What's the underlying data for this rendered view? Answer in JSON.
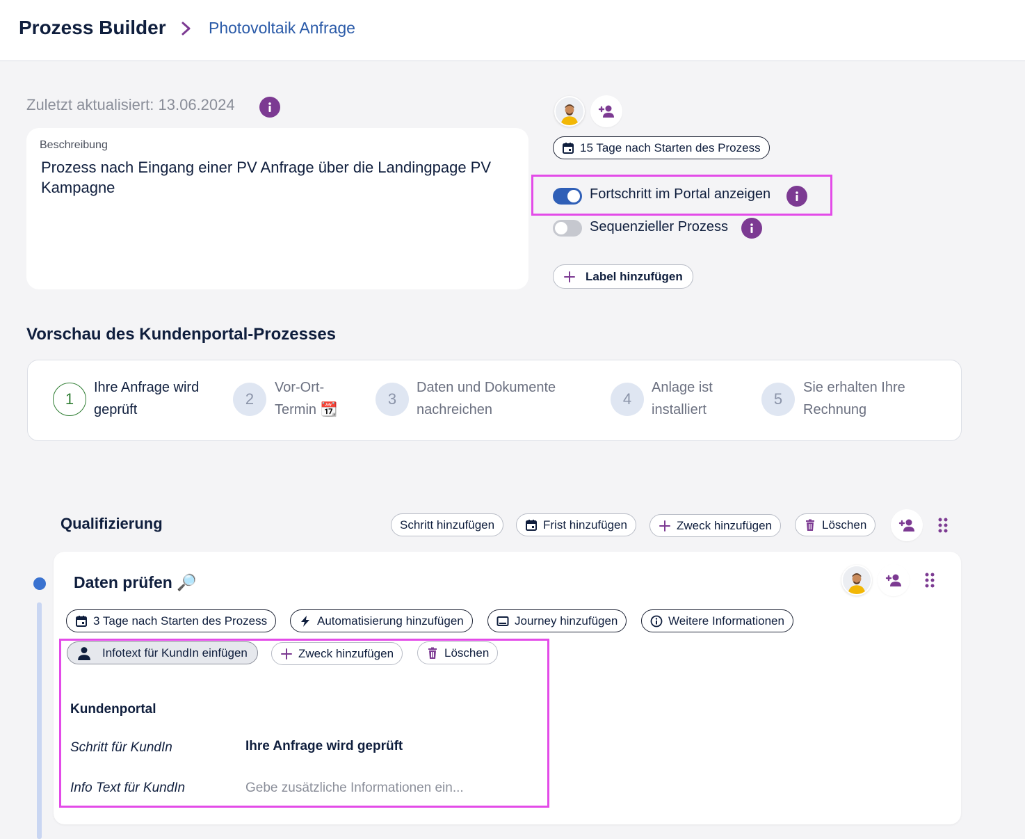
{
  "header": {
    "app_title": "Prozess Builder",
    "breadcrumb": "Photovoltaik Anfrage"
  },
  "meta": {
    "last_updated": "Zuletzt aktualisiert: 13.06.2024"
  },
  "description": {
    "label": "Beschreibung",
    "text": "Prozess nach Eingang einer PV Anfrage über die Landingpage PV Kampagne"
  },
  "settings": {
    "deadline": "15 Tage nach Starten des Prozess",
    "toggles": [
      {
        "label": "Fortschritt im Portal anzeigen",
        "on": true
      },
      {
        "label": "Sequenzieller Prozess",
        "on": false
      }
    ],
    "add_label": "Label hinzufügen"
  },
  "preview": {
    "title": "Vorschau des Kundenportal-Prozesses",
    "steps": [
      {
        "number": "1",
        "line1": "Ihre Anfrage wird",
        "line2": "geprüft",
        "active": true
      },
      {
        "number": "2",
        "line1": "Vor-Ort-",
        "line2": "Termin 📆",
        "active": false
      },
      {
        "number": "3",
        "line1": "Daten und Dokumente",
        "line2": "nachreichen",
        "active": false
      },
      {
        "number": "4",
        "line1": "Anlage ist",
        "line2": "installiert",
        "active": false
      },
      {
        "number": "5",
        "line1": "Sie erhalten Ihre",
        "line2": "Rechnung",
        "active": false
      }
    ]
  },
  "phase": {
    "title": "Qualifizierung",
    "actions": {
      "add_step": "Schritt hinzufügen",
      "add_deadline": "Frist hinzufügen",
      "add_purpose": "Zweck hinzufügen",
      "delete": "Löschen"
    }
  },
  "step": {
    "title": "Daten prüfen 🔎",
    "chips": {
      "deadline": "3 Tage nach Starten des Prozess",
      "automation": "Automatisierung hinzufügen",
      "journey": "Journey hinzufügen",
      "more_info": "Weitere Informationen",
      "infotext": "Infotext für KundIn einfügen",
      "add_purpose": "Zweck hinzufügen",
      "delete": "Löschen"
    },
    "portal": {
      "title": "Kundenportal",
      "step_label": "Schritt für KundIn",
      "step_value": "Ihre Anfrage wird geprüft",
      "info_label": "Info Text für KundIn",
      "info_placeholder": "Gebe zusätzliche Informationen ein..."
    }
  },
  "colors": {
    "accent_purple": "#7c3a92",
    "toggle_blue": "#2f5fb7",
    "highlight_magenta": "#e34be8",
    "active_step_green": "#2e7d32"
  }
}
